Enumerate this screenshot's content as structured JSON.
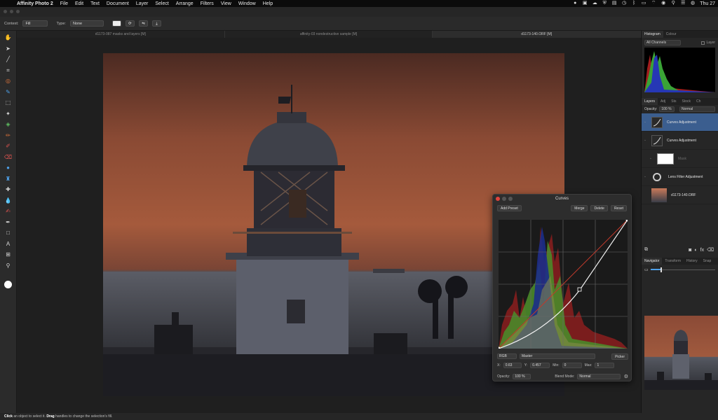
{
  "menubar": {
    "app_name": "Affinity Photo 2",
    "items": [
      "File",
      "Edit",
      "Text",
      "Document",
      "Layer",
      "Select",
      "Arrange",
      "Filters",
      "View",
      "Window",
      "Help"
    ],
    "clock": "Thu 27"
  },
  "context_toolbar": {
    "context_label": "Context:",
    "context_value": "Fill",
    "type_label": "Type:",
    "type_value": "None"
  },
  "document_tabs": [
    {
      "label": "d1173-087 masks and layers [M]",
      "active": false
    },
    {
      "label": "affinity-03 nondestructive sample [M]",
      "active": false
    },
    {
      "label": "d1173-140.ORF [M]",
      "active": true
    }
  ],
  "tools": [
    {
      "name": "view-tool-icon",
      "glyph": "✋",
      "color": ""
    },
    {
      "name": "move-tool-icon",
      "glyph": "➤",
      "color": ""
    },
    {
      "name": "color-picker-icon",
      "glyph": "╱",
      "color": ""
    },
    {
      "name": "crop-tool-icon",
      "glyph": "⌗",
      "color": ""
    },
    {
      "name": "paint-mixer-icon",
      "glyph": "◎",
      "color": "orange"
    },
    {
      "name": "selection-brush-icon",
      "glyph": "✎",
      "color": "blue"
    },
    {
      "name": "marquee-tool-icon",
      "glyph": "⬚",
      "color": ""
    },
    {
      "name": "flood-select-icon",
      "glyph": "✦",
      "color": ""
    },
    {
      "name": "fill-tool-icon",
      "glyph": "◈",
      "color": "green"
    },
    {
      "name": "brush-tool-icon",
      "glyph": "✏",
      "color": "orange"
    },
    {
      "name": "pixel-tool-icon",
      "glyph": "✐",
      "color": "red"
    },
    {
      "name": "erase-tool-icon",
      "glyph": "⌫",
      "color": "red"
    },
    {
      "name": "dodge-tool-icon",
      "glyph": "●",
      "color": "blue"
    },
    {
      "name": "clone-tool-icon",
      "glyph": "♜",
      "color": "blue"
    },
    {
      "name": "healing-tool-icon",
      "glyph": "✚",
      "color": ""
    },
    {
      "name": "blur-tool-icon",
      "glyph": "💧",
      "color": "blue"
    },
    {
      "name": "smudge-tool-icon",
      "glyph": "✍",
      "color": "red"
    },
    {
      "name": "pen-tool-icon",
      "glyph": "✒",
      "color": ""
    },
    {
      "name": "shape-tool-icon",
      "glyph": "□",
      "color": ""
    },
    {
      "name": "text-tool-icon",
      "glyph": "A",
      "color": ""
    },
    {
      "name": "mesh-warp-icon",
      "glyph": "⊞",
      "color": ""
    },
    {
      "name": "zoom-tool-icon",
      "glyph": "⚲",
      "color": ""
    }
  ],
  "status": {
    "click_word": "Click",
    "text1": " an object to select it. ",
    "drag_word": "Drag",
    "text2": " handles to change the selection's fill."
  },
  "histogram_panel": {
    "tabs": [
      "Histogram",
      "Colour"
    ],
    "channels": "All Channels",
    "layer_label": "Layer"
  },
  "layers_panel": {
    "tabs": [
      "Layers",
      "Adj",
      "Sts",
      "Stock",
      "Ch"
    ],
    "opacity_label": "Opacity:",
    "opacity_value": "100 %",
    "blend_mode": "Normal",
    "layers": [
      {
        "name": "Curves Adjustment",
        "kind": "curve",
        "selected": true,
        "child": false
      },
      {
        "name": "Curves Adjustment",
        "kind": "curve",
        "selected": false,
        "child": false
      },
      {
        "name": "Mask",
        "kind": "mask",
        "selected": false,
        "child": true
      },
      {
        "name": "Lens Filter Adjustment",
        "kind": "lens",
        "selected": false,
        "child": false
      },
      {
        "name": "d1173-140.ORF",
        "kind": "photo",
        "selected": false,
        "child": false
      }
    ]
  },
  "navigator_panel": {
    "tabs": [
      "Navigator",
      "Transform",
      "History",
      "Snap"
    ],
    "zoom_fraction": 0.15
  },
  "curves_dialog": {
    "title": "Curves",
    "add_preset": "Add Preset",
    "merge": "Merge",
    "delete": "Delete",
    "reset": "Reset",
    "colour_space": "RGB",
    "channel": "Master",
    "picker": "Picker",
    "x_label": "X:",
    "x_value": "0.63",
    "y_label": "Y:",
    "y_value": "0.457",
    "min_label": "Min:",
    "min_value": "0",
    "max_label": "Max:",
    "max_value": "1",
    "opacity_label": "Opacity:",
    "opacity_value": "100 %",
    "blend_label": "Blend Mode:",
    "blend_value": "Normal"
  }
}
